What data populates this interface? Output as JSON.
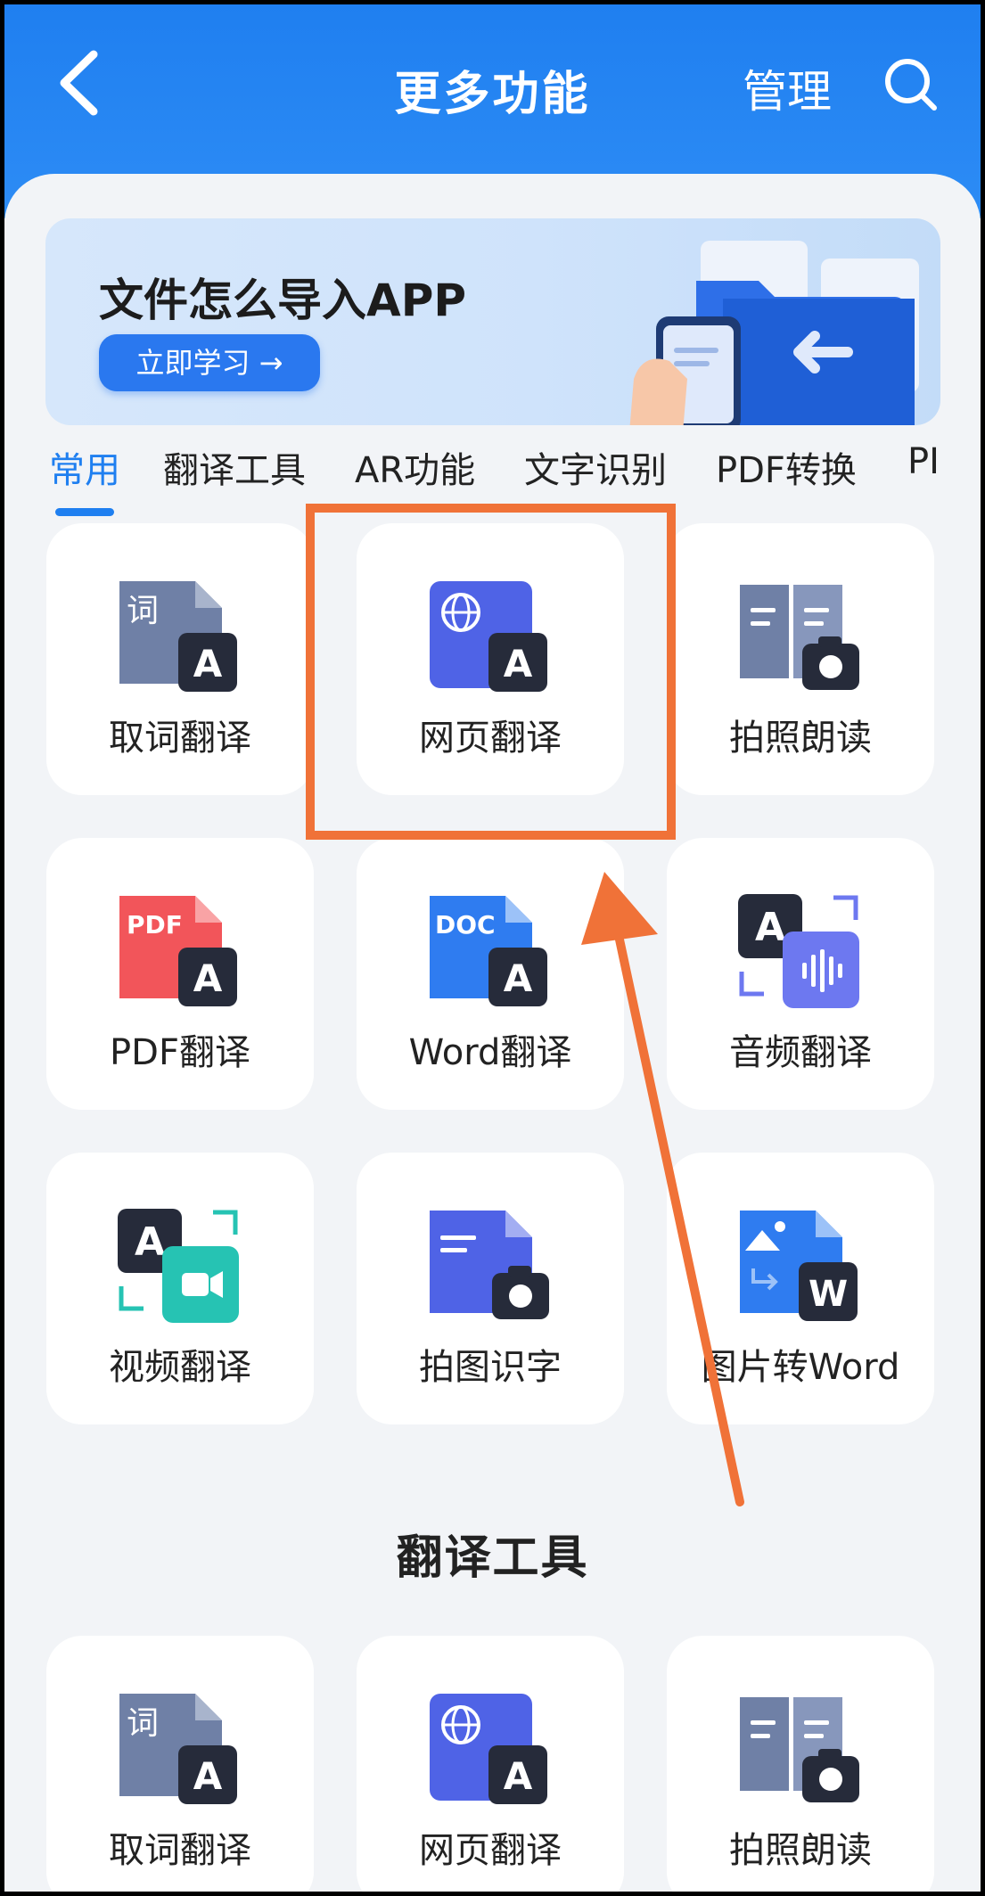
{
  "header": {
    "title": "更多功能",
    "manage_label": "管理",
    "back_icon": "chevron-left-icon",
    "search_icon": "search-icon",
    "background_color": "#1f7ff0"
  },
  "banner": {
    "title": "文件怎么导入APP",
    "button_label": "立即学习 →",
    "illustration": "folder-import-illustration"
  },
  "tabs": {
    "items": [
      "常用",
      "翻译工具",
      "AR功能",
      "文字识别",
      "PDF转换",
      "PI"
    ],
    "active_index": 0,
    "active_color": "#1f7ff0"
  },
  "common_grid": {
    "items": [
      {
        "label": "取词翻译",
        "icon": "word-pick-translate-icon"
      },
      {
        "label": "网页翻译",
        "icon": "webpage-translate-icon"
      },
      {
        "label": "拍照朗读",
        "icon": "photo-read-aloud-icon"
      },
      {
        "label": "PDF翻译",
        "icon": "pdf-translate-icon",
        "icon_text": "PDF"
      },
      {
        "label": "Word翻译",
        "icon": "doc-translate-icon",
        "icon_text": "DOC"
      },
      {
        "label": "音频翻译",
        "icon": "audio-translate-icon"
      },
      {
        "label": "视频翻译",
        "icon": "video-translate-icon"
      },
      {
        "label": "拍图识字",
        "icon": "photo-ocr-icon"
      },
      {
        "label": "图片转Word",
        "icon": "image-to-word-icon",
        "icon_text": "W"
      }
    ]
  },
  "translate_tools": {
    "title": "翻译工具",
    "items": [
      {
        "label": "取词翻译",
        "icon": "word-pick-translate-icon"
      },
      {
        "label": "网页翻译",
        "icon": "webpage-translate-icon"
      },
      {
        "label": "拍照朗读",
        "icon": "photo-read-aloud-icon"
      }
    ]
  },
  "icon_glyphs": {
    "word_char": "词",
    "letter_a": "A"
  },
  "annotation": {
    "highlight_color": "#f07238",
    "highlight_target": "网页翻译",
    "arrow_color": "#f07238"
  }
}
